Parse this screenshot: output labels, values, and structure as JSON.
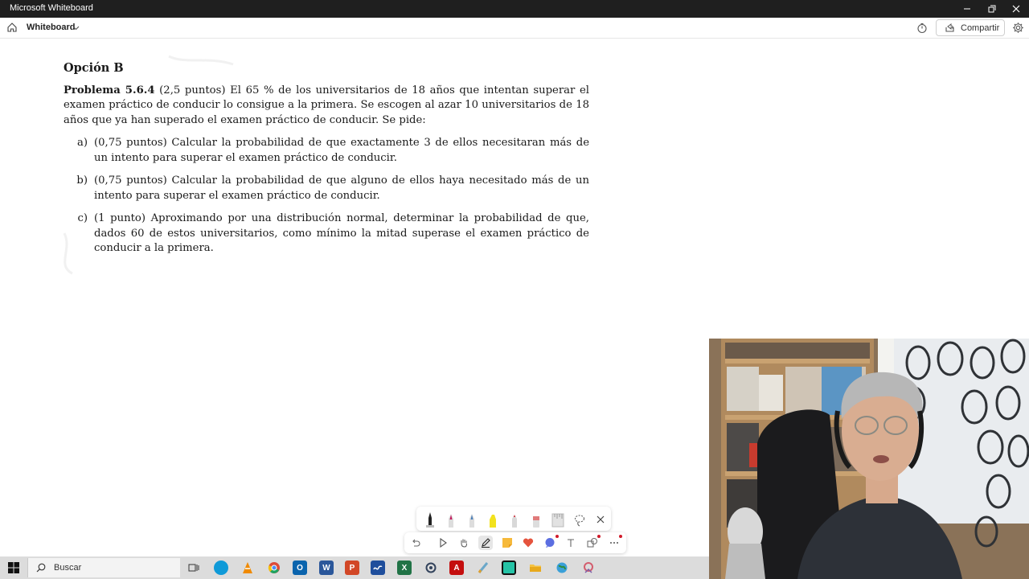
{
  "window": {
    "title": "Microsoft Whiteboard"
  },
  "appbar": {
    "app_name": "Whiteboard",
    "share_label": "Compartir"
  },
  "document": {
    "section_title": "Opción B",
    "problem_title": "Problema 5.6.4",
    "problem_text": " (2,5 puntos) El 65 % de los universitarios de 18 años que intentan superar el examen práctico de conducir lo consigue a la primera. Se escogen al azar 10 universitarios de 18 años que ya han superado el examen práctico de conducir. Se pide:",
    "items": [
      {
        "label": "a)",
        "text": "(0,75 puntos) Calcular la probabilidad de que exactamente 3 de ellos necesitaran más de un intento para superar el examen práctico de conducir."
      },
      {
        "label": "b)",
        "text": "(0,75 puntos) Calcular la probabilidad de que alguno de ellos haya necesitado más de un intento para superar el examen práctico de conducir."
      },
      {
        "label": "c)",
        "text": "(1 punto) Aproximando por una distribución normal, determinar la probabilidad de que, dados 60 de estos universitarios, como mínimo la mitad superase el examen práctico de conducir a la primera."
      }
    ]
  },
  "ink_toolbar": {
    "pens": [
      {
        "name": "black-pen",
        "color": "#222222"
      },
      {
        "name": "magenta-pen",
        "color": "#c2185b"
      },
      {
        "name": "blue-pen",
        "color": "#4a7fb8"
      },
      {
        "name": "yellow-highlighter",
        "color": "#f2e21e"
      },
      {
        "name": "red-pen",
        "color": "#c9c9c9"
      },
      {
        "name": "eraser",
        "color": "#e07a7a"
      },
      {
        "name": "ruler",
        "color": "#cfcfcf"
      }
    ],
    "accent_color": "#d11a2a"
  },
  "taskbar": {
    "search_placeholder": "Buscar",
    "background": "#dcdcdc"
  }
}
